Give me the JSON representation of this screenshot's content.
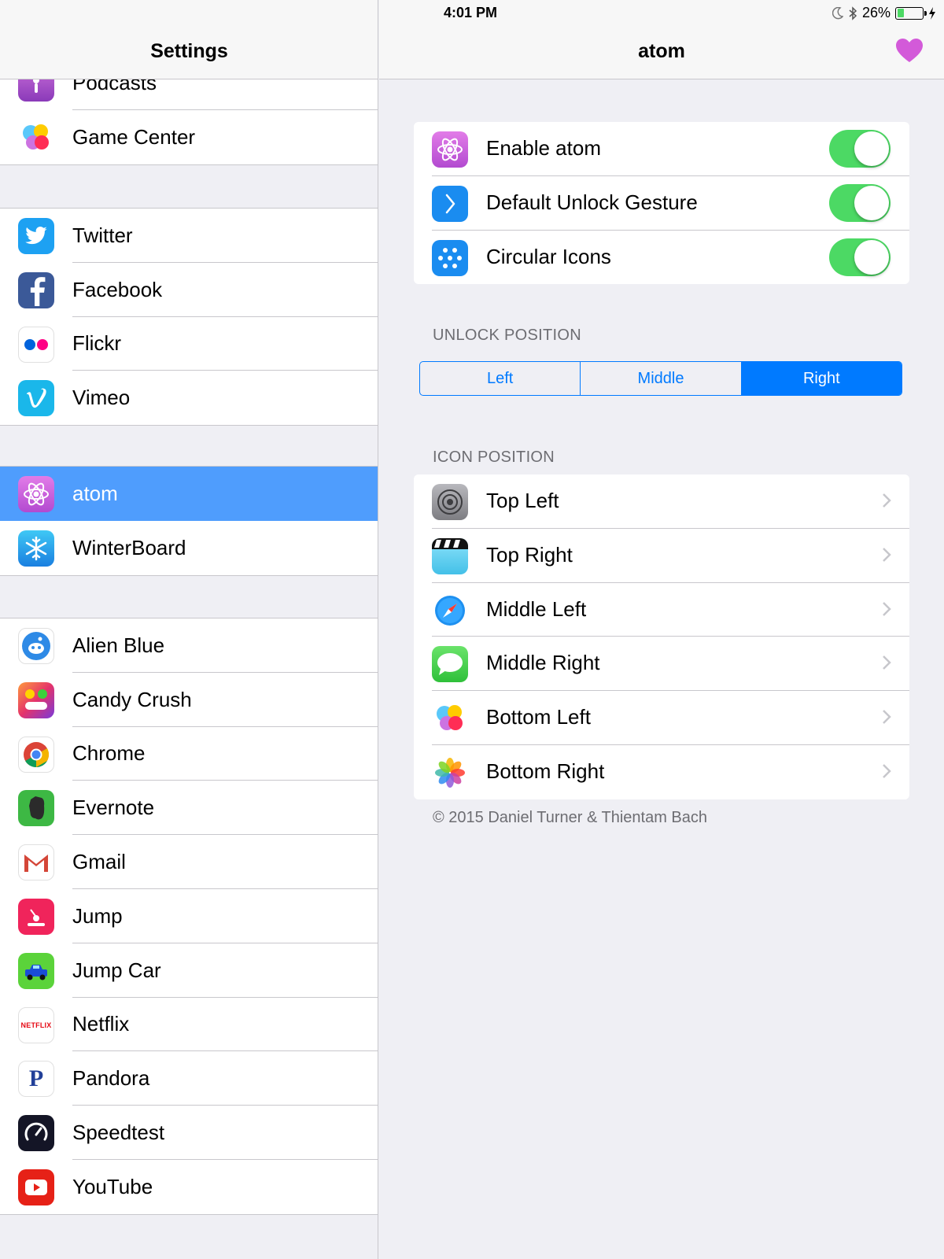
{
  "status_bar": {
    "device": "iPad",
    "time": "4:01 PM",
    "battery_percent": "26%",
    "battery_level": 0.26
  },
  "left": {
    "title": "Settings",
    "groups": [
      {
        "items": [
          {
            "label": "Podcasts",
            "icon": "podcasts-icon"
          },
          {
            "label": "Game Center",
            "icon": "game-center-icon"
          }
        ]
      },
      {
        "items": [
          {
            "label": "Twitter",
            "icon": "twitter-icon"
          },
          {
            "label": "Facebook",
            "icon": "facebook-icon"
          },
          {
            "label": "Flickr",
            "icon": "flickr-icon"
          },
          {
            "label": "Vimeo",
            "icon": "vimeo-icon"
          }
        ]
      },
      {
        "items": [
          {
            "label": "atom",
            "icon": "atom-icon",
            "selected": true
          },
          {
            "label": "WinterBoard",
            "icon": "winterboard-icon"
          }
        ]
      },
      {
        "items": [
          {
            "label": "Alien Blue",
            "icon": "alien-blue-icon"
          },
          {
            "label": "Candy Crush",
            "icon": "candy-crush-icon"
          },
          {
            "label": "Chrome",
            "icon": "chrome-icon"
          },
          {
            "label": "Evernote",
            "icon": "evernote-icon"
          },
          {
            "label": "Gmail",
            "icon": "gmail-icon"
          },
          {
            "label": "Jump",
            "icon": "jump-icon"
          },
          {
            "label": "Jump Car",
            "icon": "jump-car-icon"
          },
          {
            "label": "Netflix",
            "icon": "netflix-icon",
            "icon_text": "NETFLIX"
          },
          {
            "label": "Pandora",
            "icon": "pandora-icon",
            "icon_text": "P"
          },
          {
            "label": "Speedtest",
            "icon": "speedtest-icon"
          },
          {
            "label": "YouTube",
            "icon": "youtube-icon"
          }
        ]
      }
    ]
  },
  "right": {
    "title": "atom",
    "toggles": [
      {
        "label": "Enable atom",
        "icon": "atom-icon",
        "on": true
      },
      {
        "label": "Default Unlock Gesture",
        "icon": "unlock-gesture-icon",
        "on": true
      },
      {
        "label": "Circular Icons",
        "icon": "circular-icons-icon",
        "on": true
      }
    ],
    "unlock_position_label": "UNLOCK POSITION",
    "unlock_options": [
      "Left",
      "Middle",
      "Right"
    ],
    "unlock_selected": "Right",
    "icon_position_label": "ICON POSITION",
    "icon_positions": [
      {
        "label": "Top Left",
        "icon": "settings-gear-icon"
      },
      {
        "label": "Top Right",
        "icon": "videos-icon"
      },
      {
        "label": "Middle Left",
        "icon": "safari-icon"
      },
      {
        "label": "Middle Right",
        "icon": "messages-icon"
      },
      {
        "label": "Bottom Left",
        "icon": "game-center-icon"
      },
      {
        "label": "Bottom Right",
        "icon": "photos-icon"
      }
    ],
    "copyright": "© 2015 Daniel Turner & Thientam Bach"
  },
  "colors": {
    "accent": "#007aff",
    "selected_row": "#4f9dfd",
    "toggle_on": "#4cd964",
    "heart": "#d35ad9"
  }
}
